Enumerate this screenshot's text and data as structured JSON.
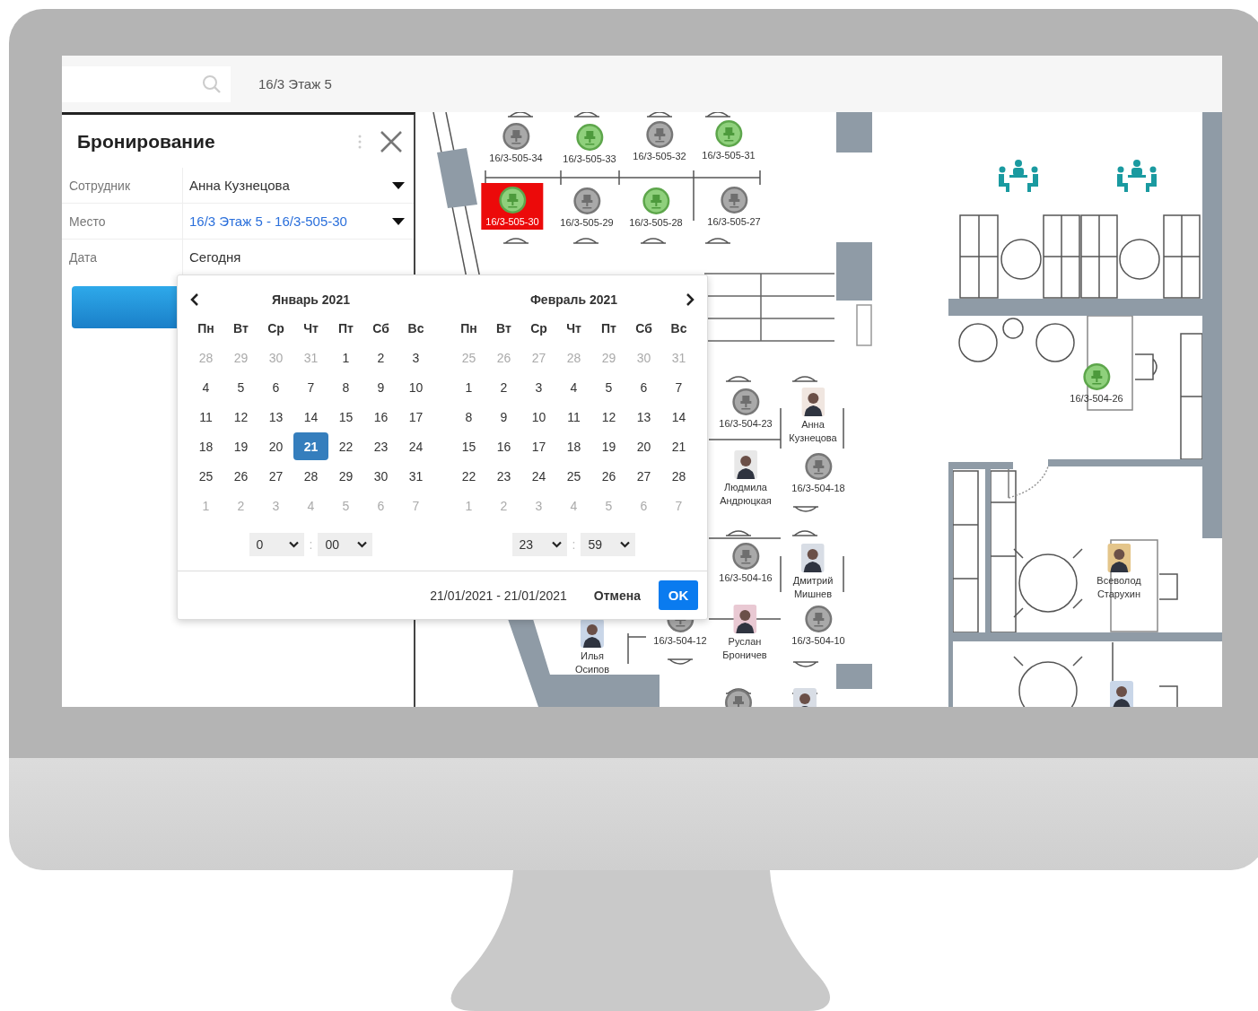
{
  "top_bar": {
    "location": "16/3 Этаж 5"
  },
  "booking_panel": {
    "title": "Бронирование",
    "fields": [
      {
        "label": "Сотрудник",
        "value": "Анна Кузнецова",
        "kind": "dropdown"
      },
      {
        "label": "Место",
        "value": "16/3 Этаж 5 - 16/3-505-30",
        "kind": "link-dropdown"
      },
      {
        "label": "Дата",
        "value": "Сегодня",
        "kind": "text"
      }
    ]
  },
  "date_picker": {
    "months": [
      {
        "title": "Январь 2021",
        "weekdays": [
          "Пн",
          "Вт",
          "Ср",
          "Чт",
          "Пт",
          "Сб",
          "Вс"
        ],
        "weeks": [
          [
            {
              "day": "28",
              "muted": true,
              "selected": false
            },
            {
              "day": "29",
              "muted": true,
              "selected": false
            },
            {
              "day": "30",
              "muted": true,
              "selected": false
            },
            {
              "day": "31",
              "muted": true,
              "selected": false
            },
            {
              "day": "1",
              "muted": false,
              "selected": false
            },
            {
              "day": "2",
              "muted": false,
              "selected": false
            },
            {
              "day": "3",
              "muted": false,
              "selected": false
            }
          ],
          [
            {
              "day": "4",
              "muted": false,
              "selected": false
            },
            {
              "day": "5",
              "muted": false,
              "selected": false
            },
            {
              "day": "6",
              "muted": false,
              "selected": false
            },
            {
              "day": "7",
              "muted": false,
              "selected": false
            },
            {
              "day": "8",
              "muted": false,
              "selected": false
            },
            {
              "day": "9",
              "muted": false,
              "selected": false
            },
            {
              "day": "10",
              "muted": false,
              "selected": false
            }
          ],
          [
            {
              "day": "11",
              "muted": false,
              "selected": false
            },
            {
              "day": "12",
              "muted": false,
              "selected": false
            },
            {
              "day": "13",
              "muted": false,
              "selected": false
            },
            {
              "day": "14",
              "muted": false,
              "selected": false
            },
            {
              "day": "15",
              "muted": false,
              "selected": false
            },
            {
              "day": "16",
              "muted": false,
              "selected": false
            },
            {
              "day": "17",
              "muted": false,
              "selected": false
            }
          ],
          [
            {
              "day": "18",
              "muted": false,
              "selected": false
            },
            {
              "day": "19",
              "muted": false,
              "selected": false
            },
            {
              "day": "20",
              "muted": false,
              "selected": false
            },
            {
              "day": "21",
              "muted": false,
              "selected": true
            },
            {
              "day": "22",
              "muted": false,
              "selected": false
            },
            {
              "day": "23",
              "muted": false,
              "selected": false
            },
            {
              "day": "24",
              "muted": false,
              "selected": false
            }
          ],
          [
            {
              "day": "25",
              "muted": false,
              "selected": false
            },
            {
              "day": "26",
              "muted": false,
              "selected": false
            },
            {
              "day": "27",
              "muted": false,
              "selected": false
            },
            {
              "day": "28",
              "muted": false,
              "selected": false
            },
            {
              "day": "29",
              "muted": false,
              "selected": false
            },
            {
              "day": "30",
              "muted": false,
              "selected": false
            },
            {
              "day": "31",
              "muted": false,
              "selected": false
            }
          ],
          [
            {
              "day": "1",
              "muted": true,
              "selected": false
            },
            {
              "day": "2",
              "muted": true,
              "selected": false
            },
            {
              "day": "3",
              "muted": true,
              "selected": false
            },
            {
              "day": "4",
              "muted": true,
              "selected": false
            },
            {
              "day": "5",
              "muted": true,
              "selected": false
            },
            {
              "day": "6",
              "muted": true,
              "selected": false
            },
            {
              "day": "7",
              "muted": true,
              "selected": false
            }
          ]
        ],
        "time": [
          "0",
          "00"
        ],
        "separator": ":"
      },
      {
        "title": "Февраль 2021",
        "weekdays": [
          "Пн",
          "Вт",
          "Ср",
          "Чт",
          "Пт",
          "Сб",
          "Вс"
        ],
        "weeks": [
          [
            {
              "day": "25",
              "muted": true,
              "selected": false
            },
            {
              "day": "26",
              "muted": true,
              "selected": false
            },
            {
              "day": "27",
              "muted": true,
              "selected": false
            },
            {
              "day": "28",
              "muted": true,
              "selected": false
            },
            {
              "day": "29",
              "muted": true,
              "selected": false
            },
            {
              "day": "30",
              "muted": true,
              "selected": false
            },
            {
              "day": "31",
              "muted": true,
              "selected": false
            }
          ],
          [
            {
              "day": "1",
              "muted": false,
              "selected": false
            },
            {
              "day": "2",
              "muted": false,
              "selected": false
            },
            {
              "day": "3",
              "muted": false,
              "selected": false
            },
            {
              "day": "4",
              "muted": false,
              "selected": false
            },
            {
              "day": "5",
              "muted": false,
              "selected": false
            },
            {
              "day": "6",
              "muted": false,
              "selected": false
            },
            {
              "day": "7",
              "muted": false,
              "selected": false
            }
          ],
          [
            {
              "day": "8",
              "muted": false,
              "selected": false
            },
            {
              "day": "9",
              "muted": false,
              "selected": false
            },
            {
              "day": "10",
              "muted": false,
              "selected": false
            },
            {
              "day": "11",
              "muted": false,
              "selected": false
            },
            {
              "day": "12",
              "muted": false,
              "selected": false
            },
            {
              "day": "13",
              "muted": false,
              "selected": false
            },
            {
              "day": "14",
              "muted": false,
              "selected": false
            }
          ],
          [
            {
              "day": "15",
              "muted": false,
              "selected": false
            },
            {
              "day": "16",
              "muted": false,
              "selected": false
            },
            {
              "day": "17",
              "muted": false,
              "selected": false
            },
            {
              "day": "18",
              "muted": false,
              "selected": false
            },
            {
              "day": "19",
              "muted": false,
              "selected": false
            },
            {
              "day": "20",
              "muted": false,
              "selected": false
            },
            {
              "day": "21",
              "muted": false,
              "selected": false
            }
          ],
          [
            {
              "day": "22",
              "muted": false,
              "selected": false
            },
            {
              "day": "23",
              "muted": false,
              "selected": false
            },
            {
              "day": "24",
              "muted": false,
              "selected": false
            },
            {
              "day": "25",
              "muted": false,
              "selected": false
            },
            {
              "day": "26",
              "muted": false,
              "selected": false
            },
            {
              "day": "27",
              "muted": false,
              "selected": false
            },
            {
              "day": "28",
              "muted": false,
              "selected": false
            }
          ],
          [
            {
              "day": "1",
              "muted": true,
              "selected": false
            },
            {
              "day": "2",
              "muted": true,
              "selected": false
            },
            {
              "day": "3",
              "muted": true,
              "selected": false
            },
            {
              "day": "4",
              "muted": true,
              "selected": false
            },
            {
              "day": "5",
              "muted": true,
              "selected": false
            },
            {
              "day": "6",
              "muted": true,
              "selected": false
            },
            {
              "day": "7",
              "muted": true,
              "selected": false
            }
          ]
        ],
        "time": [
          "23",
          "59"
        ],
        "separator": ":"
      }
    ],
    "range": "21/01/2021 - 21/01/2021",
    "cancel": "Отмена",
    "ok": "OK"
  },
  "floor_plan": {
    "places": [
      {
        "kind": "seat",
        "label": "16/3-505-34",
        "available": false,
        "selected": false
      },
      {
        "kind": "seat",
        "label": "16/3-505-33",
        "available": true,
        "selected": false
      },
      {
        "kind": "seat",
        "label": "16/3-505-32",
        "available": false,
        "selected": false
      },
      {
        "kind": "seat",
        "label": "16/3-505-31",
        "available": true,
        "selected": false
      },
      {
        "kind": "seat",
        "label": "16/3-505-30",
        "available": true,
        "selected": true
      },
      {
        "kind": "seat",
        "label": "16/3-505-29",
        "available": false,
        "selected": false
      },
      {
        "kind": "seat",
        "label": "16/3-505-28",
        "available": true,
        "selected": false
      },
      {
        "kind": "seat",
        "label": "16/3-505-27",
        "available": false,
        "selected": false
      },
      {
        "kind": "seat",
        "label": "16/3-504-23",
        "available": false,
        "selected": false
      },
      {
        "kind": "person",
        "name": "Анна Кузнецова",
        "selected": false
      },
      {
        "kind": "person",
        "name": "Людмила Андрюцкая",
        "selected": false
      },
      {
        "kind": "seat",
        "label": "16/3-504-18",
        "available": false,
        "selected": false
      },
      {
        "kind": "seat",
        "label": "16/3-504-16",
        "available": false,
        "selected": false
      },
      {
        "kind": "person",
        "name": "Дмитрий Мишнев",
        "selected": false
      },
      {
        "kind": "person",
        "name": "Илья Осипов",
        "selected": false
      },
      {
        "kind": "seat",
        "label": "16/3-504-12",
        "available": false,
        "selected": false
      },
      {
        "kind": "person",
        "name": "Руслан Броничев",
        "selected": false
      },
      {
        "kind": "seat",
        "label": "16/3-504-10",
        "available": false,
        "selected": false
      },
      {
        "kind": "seat",
        "label": "16/3-504-26",
        "available": true,
        "selected": false
      },
      {
        "kind": "person",
        "name": "Всеволод Старухин",
        "selected": false
      },
      {
        "kind": "seat",
        "available": false,
        "selected": false
      },
      {
        "kind": "person",
        "selected": false
      },
      {
        "kind": "person",
        "selected": false
      }
    ]
  }
}
